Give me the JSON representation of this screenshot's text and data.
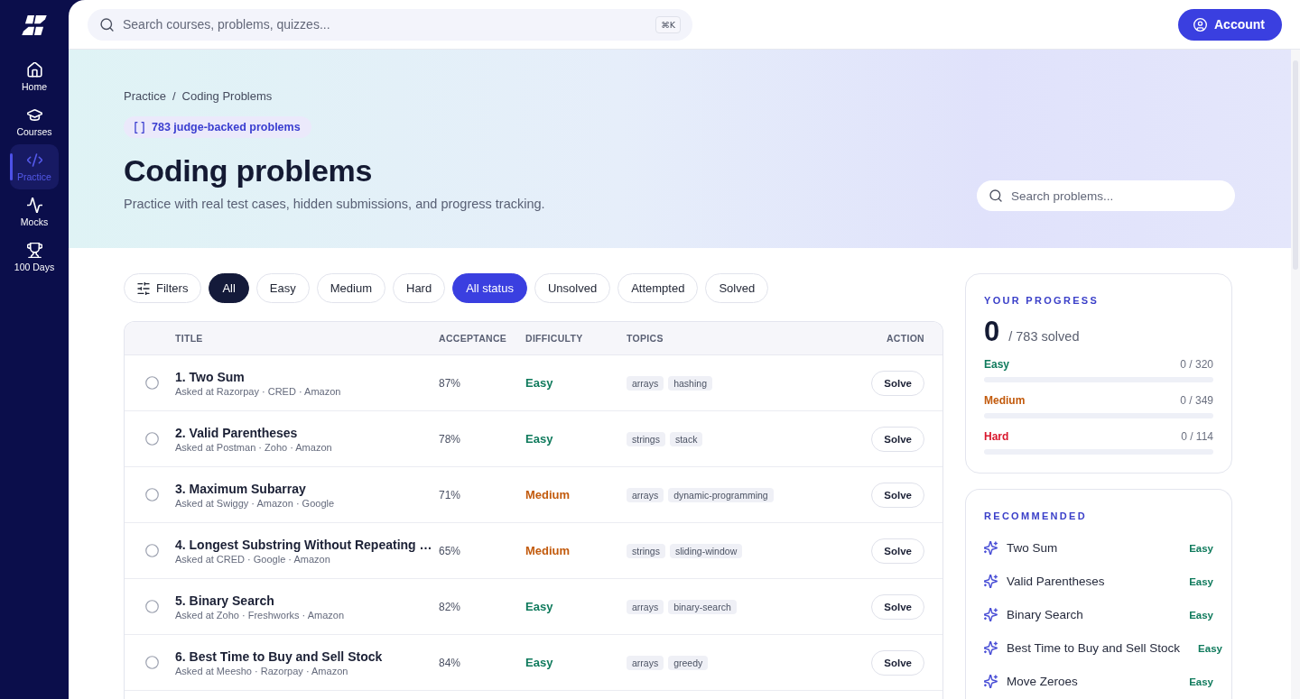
{
  "sidebar": {
    "items": [
      {
        "label": "Home",
        "selected": false
      },
      {
        "label": "Courses",
        "selected": false
      },
      {
        "label": "Practice",
        "selected": true
      },
      {
        "label": "Mocks",
        "selected": false
      },
      {
        "label": "100 Days",
        "selected": false
      }
    ]
  },
  "topbar": {
    "search": {
      "placeholder": "Search courses, problems, quizzes...",
      "shortcut": "⌘K"
    },
    "account_button": "Account"
  },
  "hero": {
    "breadcrumb": {
      "items": [
        "Practice",
        "Coding Problems"
      ],
      "separator": "/"
    },
    "badge": "783 judge-backed problems",
    "title": "Coding problems",
    "subtitle": "Practice with real test cases, hidden submissions, and progress tracking.",
    "search": {
      "placeholder": "Search problems..."
    }
  },
  "filters": {
    "button": "Filters",
    "difficulty": [
      {
        "label": "All",
        "selected": true
      },
      {
        "label": "Easy",
        "selected": false
      },
      {
        "label": "Medium",
        "selected": false
      },
      {
        "label": "Hard",
        "selected": false
      }
    ],
    "status": [
      {
        "label": "All status",
        "selected": true
      },
      {
        "label": "Unsolved",
        "selected": false
      },
      {
        "label": "Attempted",
        "selected": false
      },
      {
        "label": "Solved",
        "selected": false
      }
    ]
  },
  "table": {
    "columns": [
      "TITLE",
      "ACCEPTANCE",
      "DIFFICULTY",
      "TOPICS",
      "ACTION"
    ],
    "rows": [
      {
        "solved": false,
        "title": "1. Two Sum",
        "companies": "Asked at Razorpay · CRED · Amazon",
        "acceptance": "87%",
        "difficulty": "Easy",
        "color": "#0f7a5c",
        "topics": [
          "arrays",
          "hashing"
        ],
        "action": "Solve"
      },
      {
        "solved": false,
        "title": "2. Valid Parentheses",
        "companies": "Asked at Postman · Zoho · Amazon",
        "acceptance": "78%",
        "difficulty": "Easy",
        "color": "#0f7a5c",
        "topics": [
          "strings",
          "stack"
        ],
        "action": "Solve"
      },
      {
        "solved": false,
        "title": "3. Maximum Subarray",
        "companies": "Asked at Swiggy · Amazon · Google",
        "acceptance": "71%",
        "difficulty": "Medium",
        "color": "#c25a0c",
        "topics": [
          "arrays",
          "dynamic-programming"
        ],
        "action": "Solve"
      },
      {
        "solved": false,
        "title": "4. Longest Substring Without Repeating …",
        "companies": "Asked at CRED · Google · Amazon",
        "acceptance": "65%",
        "difficulty": "Medium",
        "color": "#c25a0c",
        "topics": [
          "strings",
          "sliding-window"
        ],
        "action": "Solve"
      },
      {
        "solved": false,
        "title": "5. Binary Search",
        "companies": "Asked at Zoho · Freshworks · Amazon",
        "acceptance": "82%",
        "difficulty": "Easy",
        "color": "#0f7a5c",
        "topics": [
          "arrays",
          "binary-search"
        ],
        "action": "Solve"
      },
      {
        "solved": false,
        "title": "6. Best Time to Buy and Sell Stock",
        "companies": "Asked at Meesho · Razorpay · Amazon",
        "acceptance": "84%",
        "difficulty": "Easy",
        "color": "#0f7a5c",
        "topics": [
          "arrays",
          "greedy"
        ],
        "action": "Solve"
      }
    ]
  },
  "progress": {
    "title": "YOUR PROGRESS",
    "solved": "0",
    "total": "/ 783 solved",
    "breakdown": [
      {
        "label": "Easy",
        "count": "0 / 320",
        "level": 0,
        "color": "#0f7a5c"
      },
      {
        "label": "Medium",
        "count": "0 / 349",
        "level": 0,
        "color": "#c25a0c"
      },
      {
        "label": "Hard",
        "count": "0 / 114",
        "level": 0,
        "color": "#d9162c"
      }
    ]
  },
  "recommended": {
    "title": "RECOMMENDED",
    "items": [
      {
        "title": "Two Sum",
        "difficulty": "Easy",
        "color": "#0f7a5c"
      },
      {
        "title": "Valid Parentheses",
        "difficulty": "Easy",
        "color": "#0f7a5c"
      },
      {
        "title": "Binary Search",
        "difficulty": "Easy",
        "color": "#0f7a5c"
      },
      {
        "title": "Best Time to Buy and Sell Stock",
        "difficulty": "Easy",
        "color": "#0f7a5c"
      },
      {
        "title": "Move Zeroes",
        "difficulty": "Easy",
        "color": "#0f7a5c"
      }
    ]
  }
}
